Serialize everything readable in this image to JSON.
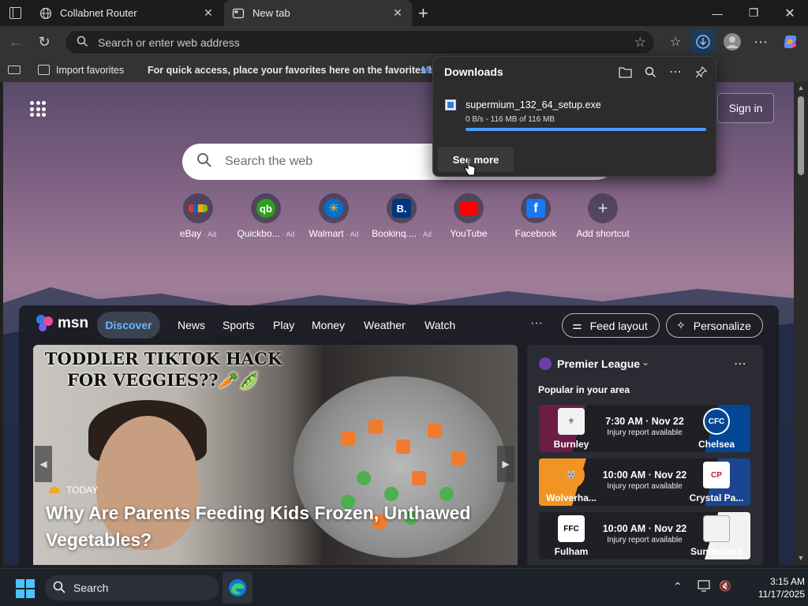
{
  "browser": {
    "tabs": [
      {
        "label": "Collabnet Router",
        "icon": "globe-icon"
      },
      {
        "label": "New tab",
        "icon": "page-icon"
      }
    ],
    "address_placeholder": "Search or enter web address",
    "favorites_bar": {
      "import_label": "Import favorites",
      "message": "For quick access, place your favorites here on the favorites bar.",
      "link": "Ma"
    }
  },
  "downloads": {
    "title": "Downloads",
    "file_name": "supermium_132_64_setup.exe",
    "status": "0 B/s - 116 MB of 116 MB",
    "progress_percent": 100,
    "see_more_label": "See more"
  },
  "newtab": {
    "sign_in_label": "Sign in",
    "search_placeholder": "Search the web",
    "shortcuts": [
      {
        "label": "eBay",
        "ad": "· Ad",
        "icon": "ebay-icon"
      },
      {
        "label": "Quickbo...",
        "ad": "· Ad",
        "icon": "quickbooks-icon"
      },
      {
        "label": "Walmart",
        "ad": "· Ad",
        "icon": "walmart-icon"
      },
      {
        "label": "Bookinq....",
        "ad": "· Ad",
        "icon": "booking-icon"
      },
      {
        "label": "YouTube",
        "ad": "",
        "icon": "youtube-icon"
      },
      {
        "label": "Facebook",
        "ad": "",
        "icon": "facebook-icon"
      },
      {
        "label": "Add shortcut",
        "ad": "",
        "icon": "plus-icon"
      }
    ]
  },
  "feed": {
    "logo_text": "msn",
    "nav": [
      "Discover",
      "News",
      "Sports",
      "Play",
      "Money",
      "Weather",
      "Watch"
    ],
    "more": "···",
    "feed_layout_label": "Feed layout",
    "personalize_label": "Personalize",
    "hero": {
      "banner_line1": "TODDLER TIKTOK HACK",
      "banner_line2": "FOR VEGGIES??🥕🫛",
      "source": "TODAY",
      "headline": "Why Are Parents Feeding Kids Frozen, Unthawed Vegetables?"
    },
    "sports": {
      "league": "Premier League",
      "subtitle": "Popular in your area",
      "matches": [
        {
          "home": "Burnley",
          "away": "Chelsea",
          "time": "7:30 AM · Nov 22",
          "note": "Injury report available"
        },
        {
          "home": "Wolverha...",
          "away": "Crystal Pa...",
          "time": "10:00 AM · Nov 22",
          "note": "Injury report available"
        },
        {
          "home": "Fulham",
          "away": "Sunderland",
          "time": "10:00 AM · Nov 22",
          "note": "Injury report available"
        }
      ]
    }
  },
  "taskbar": {
    "search_label": "Search",
    "time": "3:15 AM",
    "date": "11/17/2025"
  }
}
